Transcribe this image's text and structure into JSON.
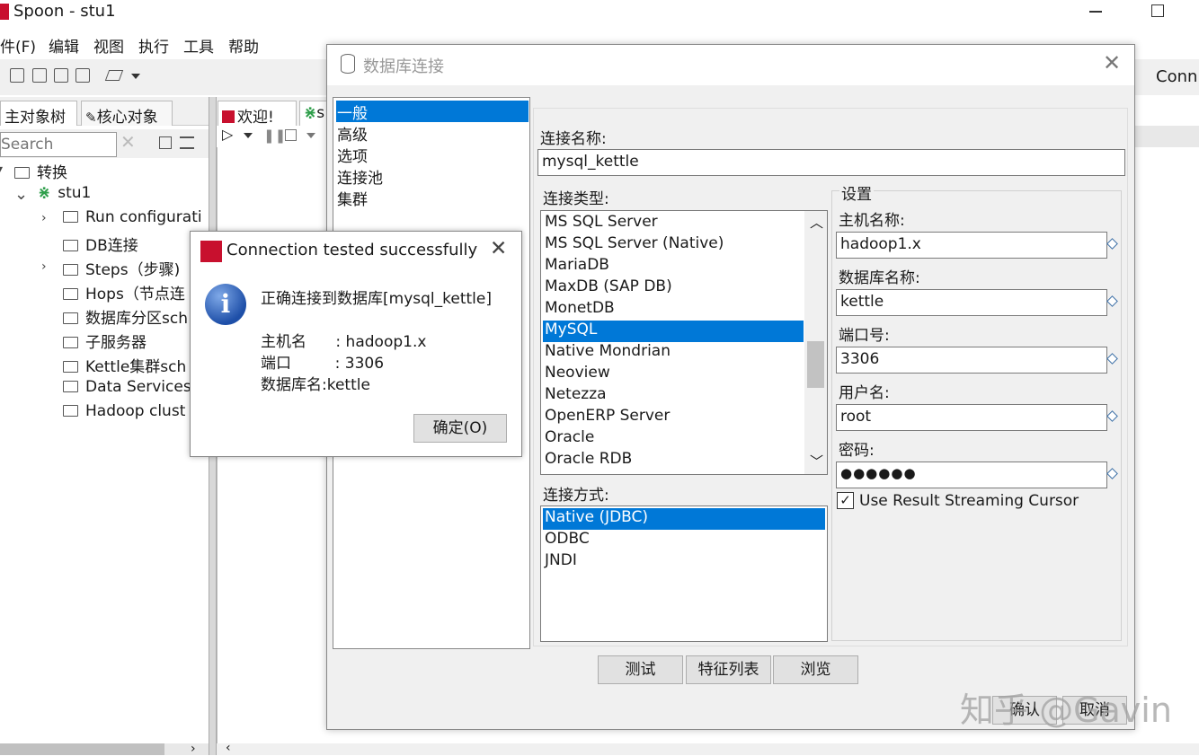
{
  "window": {
    "title": "Spoon - stu1"
  },
  "menu": [
    "件(F)",
    "编辑",
    "视图",
    "执行",
    "工具",
    "帮助"
  ],
  "left_tabs": [
    "主对象树",
    "核心对象"
  ],
  "search": {
    "placeholder": "Search"
  },
  "tree": {
    "root": "转换",
    "child": "stu1",
    "items": [
      "Run configurati",
      "DB连接",
      "Steps（步骤)",
      "Hops（节点连",
      "数据库分区sch",
      "子服务器",
      "Kettle集群sch",
      "Data Services",
      "Hadoop clust"
    ]
  },
  "right_tabs": [
    "欢迎!",
    "s"
  ],
  "far_right_label": "Conn",
  "db_dialog": {
    "title": "数据库连接",
    "nav": [
      "一般",
      "高级",
      "选项",
      "连接池",
      "集群"
    ],
    "conn_name_label": "连接名称:",
    "conn_name": "mysql_kettle",
    "conn_type_label": "连接类型:",
    "conn_types": [
      "MS SQL Server",
      "MS SQL Server (Native)",
      "MariaDB",
      "MaxDB (SAP DB)",
      "MonetDB",
      "MySQL",
      "Native Mondrian",
      "Neoview",
      "Netezza",
      "OpenERP Server",
      "Oracle",
      "Oracle RDB"
    ],
    "access_label": "连接方式:",
    "access_methods": [
      "Native (JDBC)",
      "ODBC",
      "JNDI"
    ],
    "settings_label": "设置",
    "host_label": "主机名称:",
    "host": "hadoop1.x",
    "db_label": "数据库名称:",
    "db": "kettle",
    "port_label": "端口号:",
    "port": "3306",
    "user_label": "用户名:",
    "user": "root",
    "pass_label": "密码:",
    "pass": "●●●●●●",
    "streaming_label": "Use Result Streaming Cursor",
    "buttons": {
      "test": "测试",
      "features": "特征列表",
      "explore": "浏览",
      "ok": "确认",
      "cancel": "取消"
    }
  },
  "popup": {
    "title": "Connection tested successfully",
    "message": "正确连接到数据库[mysql_kettle]",
    "host_line": "主机名      : hadoop1.x",
    "port_line": "端口         : 3306",
    "db_line": "数据库名:kettle",
    "ok": "确定(O)"
  },
  "watermark": "知乎 @Gavin"
}
